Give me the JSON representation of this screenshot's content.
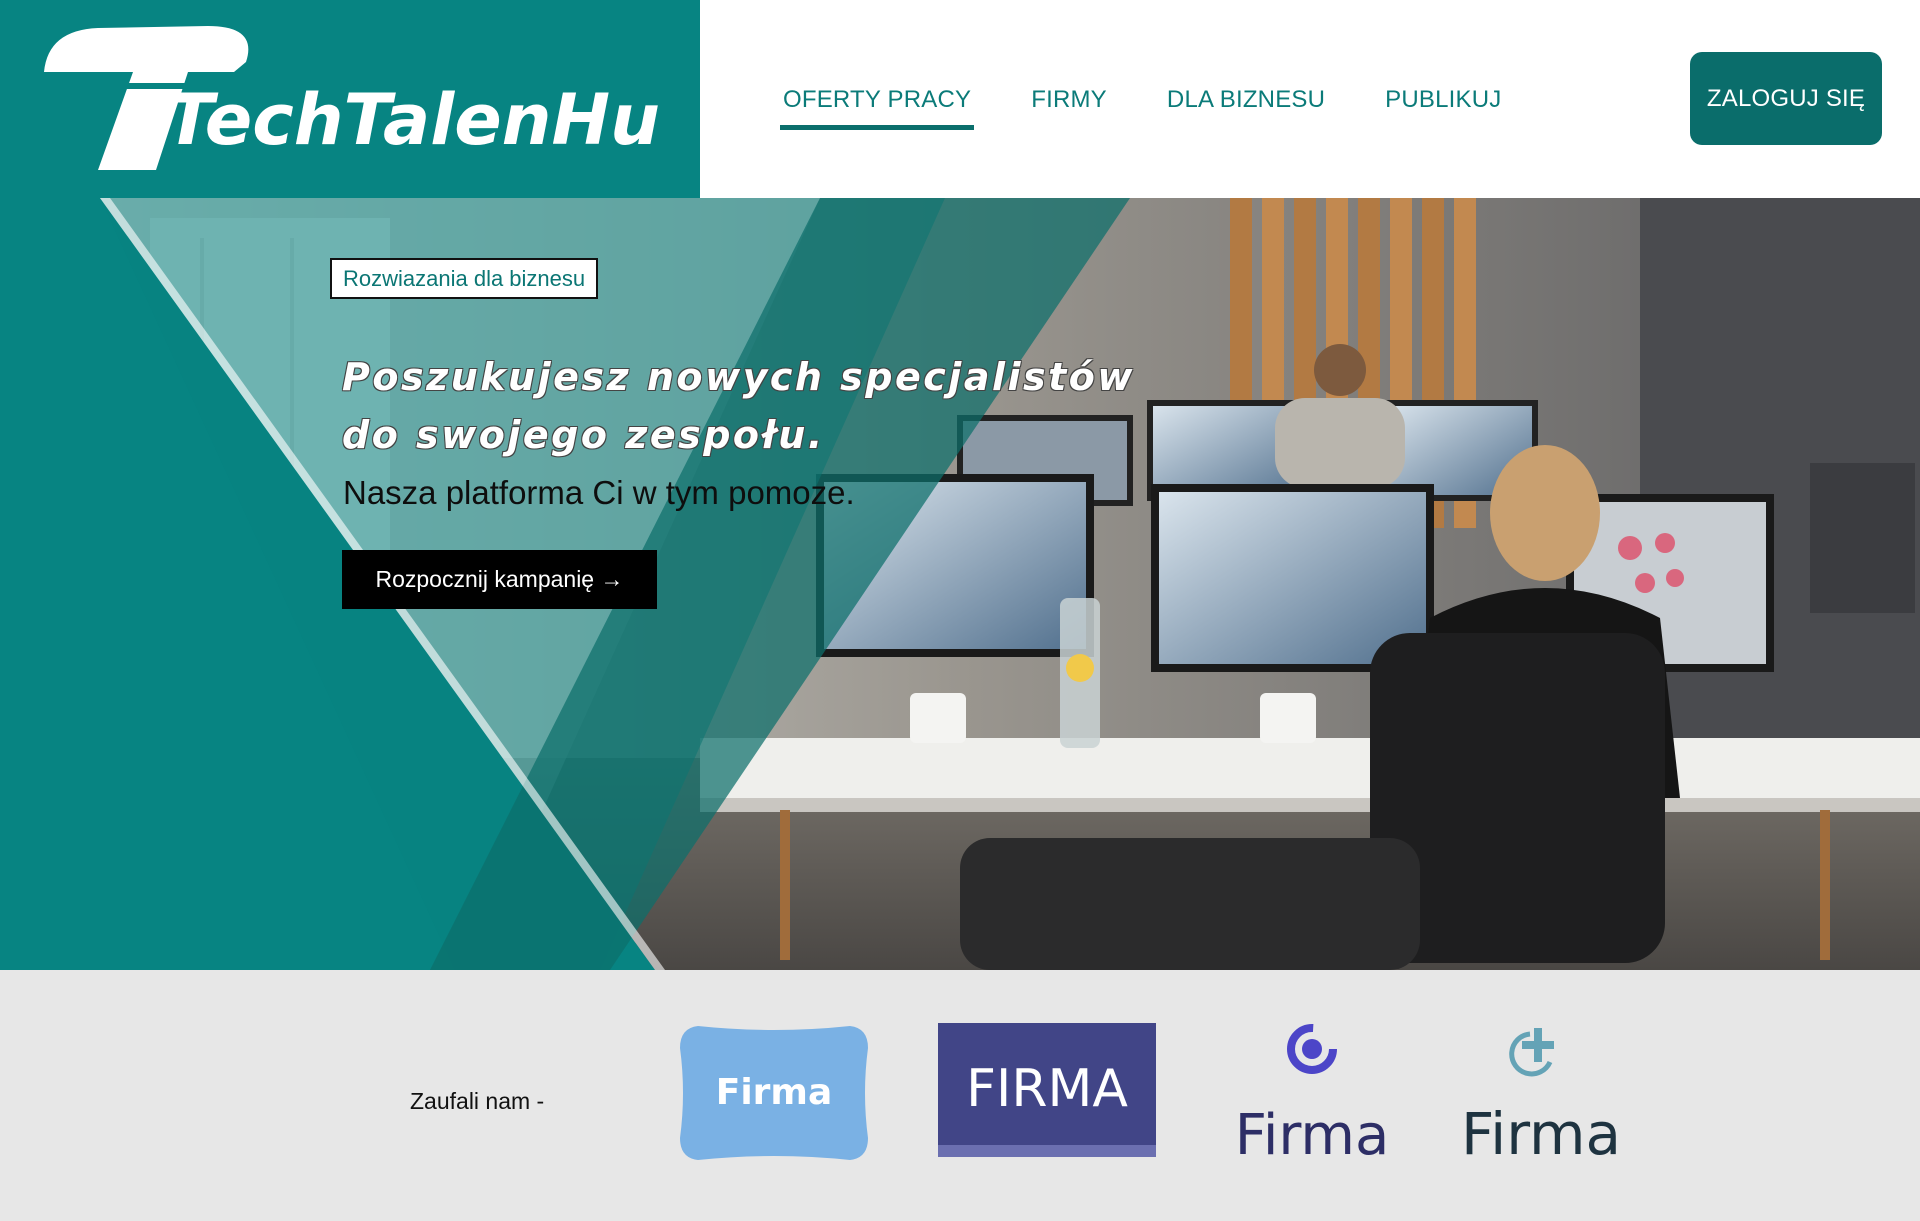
{
  "header": {
    "logo_text": "TechTalenHub",
    "nav": [
      {
        "label": "OFERTY PRACY",
        "active": true
      },
      {
        "label": "FIRMY",
        "active": false
      },
      {
        "label": "DLA BIZNESU",
        "active": false
      },
      {
        "label": "PUBLIKUJ",
        "active": false
      }
    ],
    "login_label": "ZALOGUJ SIĘ"
  },
  "hero": {
    "badge": "Rozwiazania dla biznesu",
    "title_line1": "Poszukujesz nowych specjalistów",
    "title_line2": "do swojego zespołu.",
    "subtitle": "Nasza platforma Ci w tym pomoze.",
    "cta_label": "Rozpocznij kampanię →"
  },
  "trust": {
    "label": "Zaufali nam -",
    "partners": [
      {
        "name": "Firma",
        "style": "light-blue-badge"
      },
      {
        "name": "FIRMA",
        "style": "indigo-box"
      },
      {
        "name": "Firma",
        "style": "indigo-ring-icon"
      },
      {
        "name": "Firma",
        "style": "teal-plus-icon"
      }
    ]
  },
  "colors": {
    "brand_teal": "#078482",
    "nav_text": "#0b7b79",
    "login_bg": "#0a6d6b",
    "trust_bg": "#e7e7e7"
  }
}
